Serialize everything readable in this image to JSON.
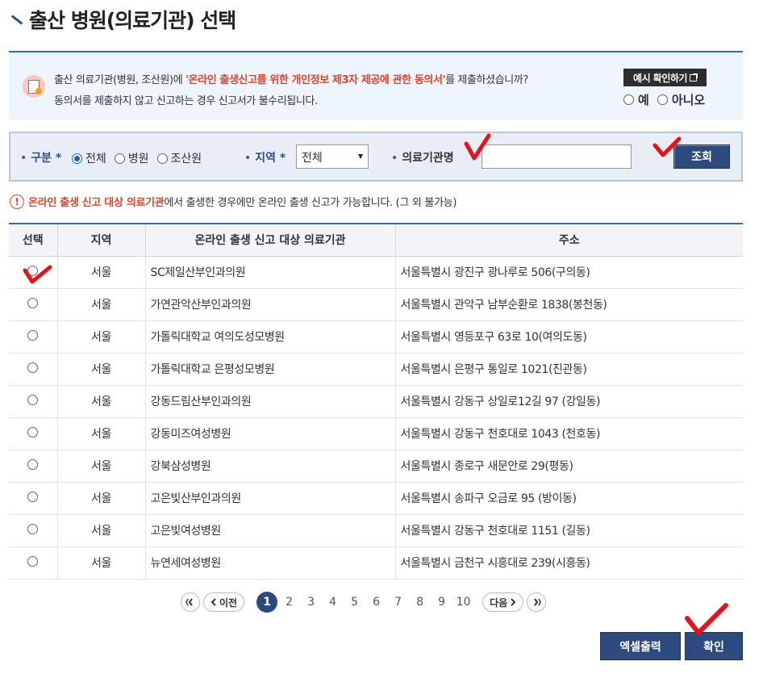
{
  "page": {
    "title": "출산 병원(의료기관) 선택"
  },
  "consent": {
    "text_prefix": "출산 의료기관(병원, 조산원)에 ",
    "text_highlight": "'온라인 출생신고를 위한 개인정보 제3자 제공에 관한 동의서'",
    "text_suffix": "를 제출하셨습니까?",
    "text_line2": "동의서를 제출하지 않고 신고하는 경우 신고서가 불수리됩니다.",
    "example_button": "예시 확인하기",
    "yes_label": "예",
    "no_label": "아니오"
  },
  "search": {
    "type_label": "구분",
    "type_options": [
      "전체",
      "병원",
      "조산원"
    ],
    "type_selected": "전체",
    "region_label": "지역",
    "region_value": "전체",
    "institution_label": "의료기관명",
    "institution_value": "",
    "query_button": "조회",
    "required_mark": "*",
    "bullet": "•"
  },
  "notice": {
    "icon": "!",
    "highlight": "온라인 출생 신고 대상 의료기관",
    "text": "에서 출생한 경우에만 온라인 출생 신고가 가능합니다. (그 외 불가능)"
  },
  "table": {
    "headers": [
      "선택",
      "지역",
      "온라인 출생 신고 대상 의료기관",
      "주소"
    ],
    "rows": [
      {
        "region": "서울",
        "name": "SC제일산부인과의원",
        "address": "서울특별시 광진구 광나루로 506(구의동)"
      },
      {
        "region": "서울",
        "name": "가연관악산부인과의원",
        "address": "서울특별시 관악구 남부순환로 1838(봉천동)"
      },
      {
        "region": "서울",
        "name": "가톨릭대학교 여의도성모병원",
        "address": "서울특별시 영등포구 63로 10(여의도동)"
      },
      {
        "region": "서울",
        "name": "가톨릭대학교 은평성모병원",
        "address": "서울특별시 은평구 통일로 1021(진관동)"
      },
      {
        "region": "서울",
        "name": "강동드림산부인과의원",
        "address": "서울특별시 강동구 상일로12길 97 (강일동)"
      },
      {
        "region": "서울",
        "name": "강동미즈여성병원",
        "address": "서울특별시 강동구 천호대로 1043 (천호동)"
      },
      {
        "region": "서울",
        "name": "강북삼성병원",
        "address": "서울특별시 종로구 새문안로 29(평동)"
      },
      {
        "region": "서울",
        "name": "고은빛산부인과의원",
        "address": "서울특별시 송파구 오금로 95 (방이동)"
      },
      {
        "region": "서울",
        "name": "고은빛여성병원",
        "address": "서울특별시 강동구 천호대로 1151 (길동)"
      },
      {
        "region": "서울",
        "name": "뉴연세여성병원",
        "address": "서울특별시 금천구 시흥대로 239(시흥동)"
      }
    ]
  },
  "pager": {
    "prev_label": "이전",
    "next_label": "다음",
    "pages": [
      "1",
      "2",
      "3",
      "4",
      "5",
      "6",
      "7",
      "8",
      "9",
      "10"
    ],
    "current": "1"
  },
  "actions": {
    "excel_label": "엑셀출력",
    "confirm_label": "확인"
  },
  "colors": {
    "primary": "#2d4a7e",
    "accent_red": "#e0432b",
    "annotation_red": "#e8121b"
  }
}
